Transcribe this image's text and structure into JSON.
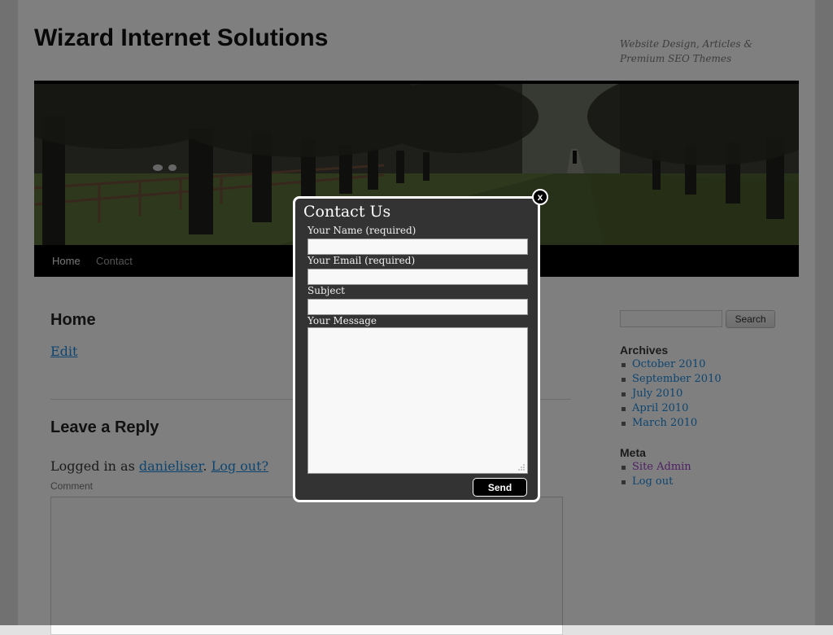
{
  "site": {
    "title": "Wizard Internet Solutions",
    "description": "Website Design, Articles & Premium SEO Themes"
  },
  "nav": {
    "items": [
      {
        "label": "Home"
      },
      {
        "label": "Contact"
      }
    ]
  },
  "content": {
    "page_title": "Home",
    "edit_link": "Edit",
    "reply_title": "Leave a Reply",
    "logged_in_prefix": "Logged in as",
    "username": "danieliser",
    "sep": ".",
    "logout": "Log out?",
    "comment_label": "Comment"
  },
  "sidebar": {
    "search_button": "Search",
    "archives_title": "Archives",
    "archives": [
      "October 2010",
      "September 2010",
      "July 2010",
      "April 2010",
      "March 2010"
    ],
    "meta_title": "Meta",
    "meta": [
      "Site Admin",
      "Log out"
    ]
  },
  "modal": {
    "title": "Contact Us",
    "name_label": "Your Name (required)",
    "email_label": "Your Email (required)",
    "subject_label": "Subject",
    "message_label": "Your Message",
    "send_label": "Send",
    "close_label": "x"
  }
}
